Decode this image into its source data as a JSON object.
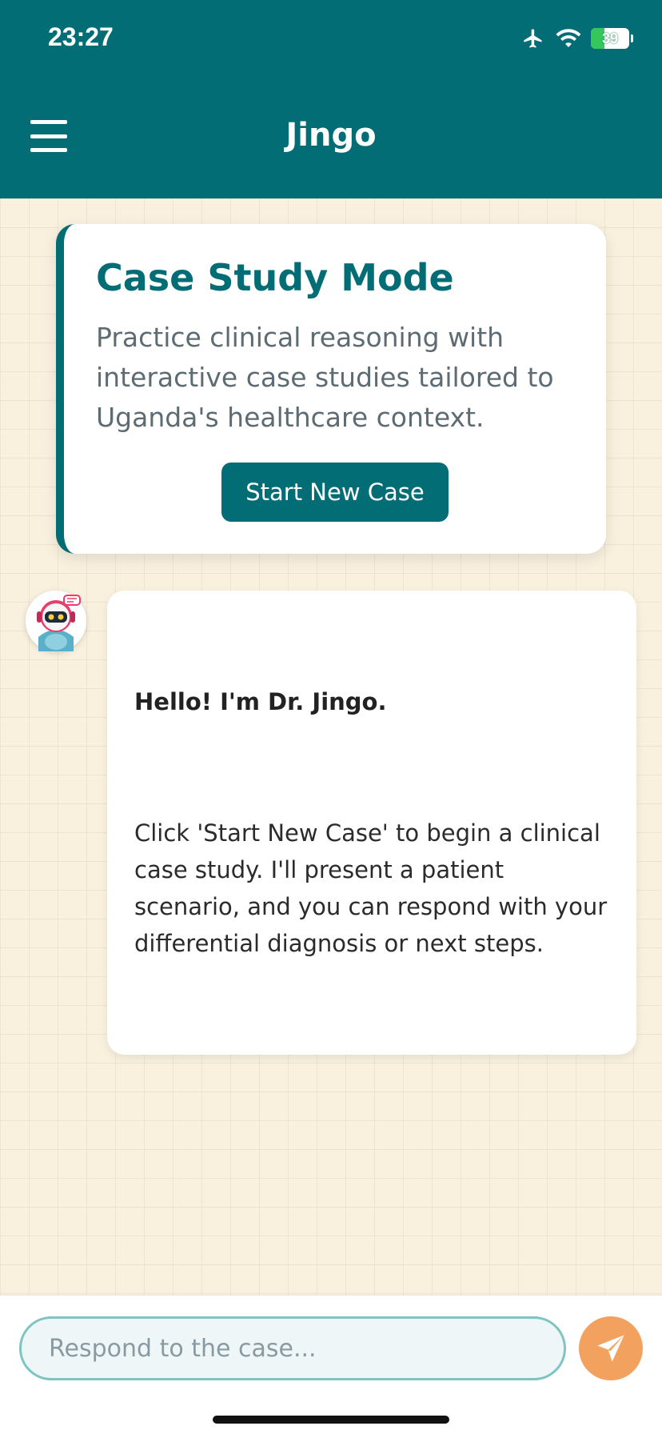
{
  "status_bar": {
    "time": "23:27",
    "battery": "39"
  },
  "header": {
    "title": "Jingo"
  },
  "case_card": {
    "title": "Case Study Mode",
    "description": "Practice clinical reasoning with interactive case studies tailored to Uganda's healthcare context.",
    "button_label": "Start New Case"
  },
  "message": {
    "greeting": "Hello! I'm Dr. Jingo.",
    "body": "Click 'Start New Case' to begin a clinical case study. I'll present a patient scenario, and you can respond with your differential diagnosis or next steps."
  },
  "composer": {
    "placeholder": "Respond to the case..."
  },
  "colors": {
    "primary": "#036d75",
    "background": "#f9f1de",
    "send": "#f3a15f"
  }
}
